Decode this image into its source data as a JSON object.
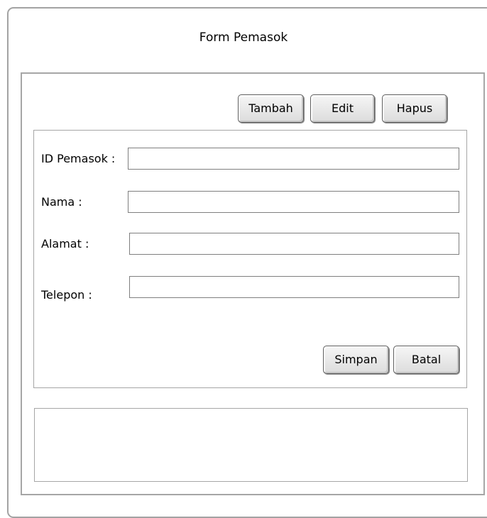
{
  "form": {
    "title": "Form Pemasok"
  },
  "toolbar": {
    "tambah_label": "Tambah",
    "edit_label": "Edit",
    "hapus_label": "Hapus"
  },
  "fields": {
    "id_pemasok": {
      "label": "ID Pemasok :",
      "value": ""
    },
    "nama": {
      "label": "Nama :",
      "value": ""
    },
    "alamat": {
      "label": "Alamat :",
      "value": ""
    },
    "telepon": {
      "label": "Telepon :",
      "value": ""
    }
  },
  "actions": {
    "simpan_label": "Simpan",
    "batal_label": "Batal"
  }
}
